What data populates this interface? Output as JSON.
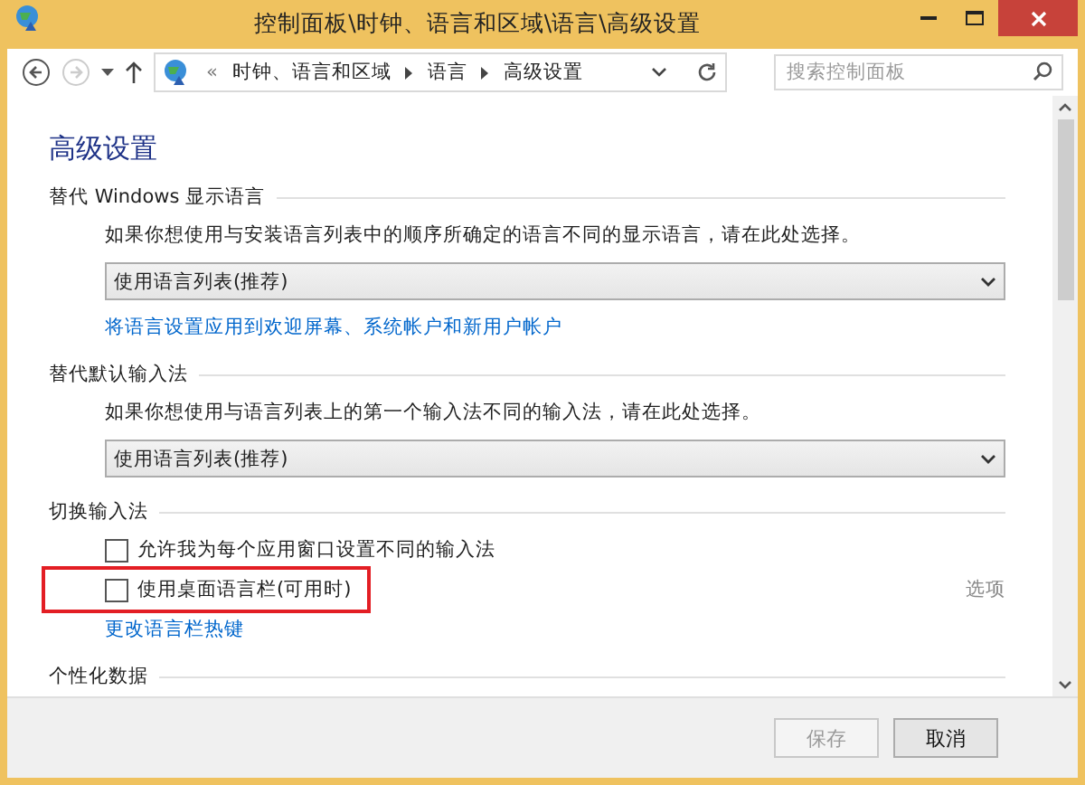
{
  "window": {
    "title": "控制面板\\时钟、语言和区域\\语言\\高级设置"
  },
  "nav": {
    "back_disabled": false,
    "forward_disabled": true,
    "breadcrumb": [
      "«",
      "时钟、语言和区域",
      "语言",
      "高级设置"
    ],
    "search": {
      "placeholder": "搜索控制面板"
    }
  },
  "heading": "高级设置",
  "sections": [
    {
      "title": "替代 Windows 显示语言",
      "items": [
        {
          "kind": "text",
          "text": "如果你想使用与安装语言列表中的顺序所确定的语言不同的显示语言，请在此处选择。"
        },
        {
          "kind": "select",
          "value": "使用语言列表(推荐)"
        },
        {
          "kind": "link",
          "text": "将语言设置应用到欢迎屏幕、系统帐户和新用户帐户"
        }
      ]
    },
    {
      "title": "替代默认输入法",
      "items": [
        {
          "kind": "text",
          "text": "如果你想使用与语言列表上的第一个输入法不同的输入法，请在此处选择。"
        },
        {
          "kind": "select",
          "value": "使用语言列表(推荐)"
        }
      ]
    },
    {
      "title": "切换输入法",
      "items": [
        {
          "kind": "checkbox",
          "text": "允许我为每个应用窗口设置不同的输入法",
          "checked": false
        },
        {
          "kind": "checkbox",
          "text": "使用桌面语言栏(可用时)",
          "checked": false,
          "framed": true,
          "option": "选项"
        },
        {
          "kind": "link",
          "text": "更改语言栏热键"
        }
      ]
    },
    {
      "title": "个性化数据"
    }
  ],
  "buttons": [
    {
      "label": "保存",
      "disabled": true
    },
    {
      "label": "取消",
      "disabled": false
    }
  ]
}
